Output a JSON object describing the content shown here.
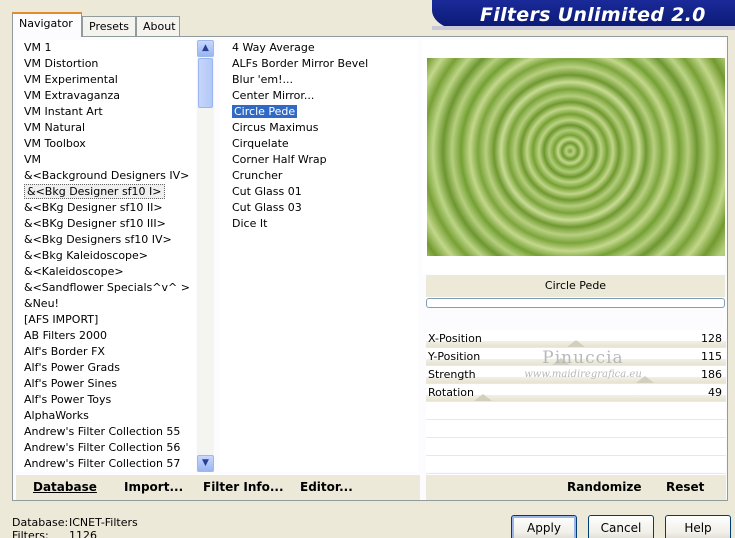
{
  "tabs": [
    "Navigator",
    "Presets",
    "About"
  ],
  "brand_title": "Filters Unlimited 2.0",
  "categories": [
    "VM 1",
    "VM Distortion",
    "VM Experimental",
    "VM Extravaganza",
    "VM Instant Art",
    "VM Natural",
    "VM Toolbox",
    "VM",
    "&<Background Designers IV>",
    "&<Bkg Designer sf10 I>",
    "&<BKg Designer sf10 II>",
    "&<BKg Designer sf10 III>",
    "&<Bkg Designers sf10 IV>",
    "&<Bkg Kaleidoscope>",
    "&<Kaleidoscope>",
    "&<Sandflower Specials^v^ >",
    "&Neu!",
    "[AFS IMPORT]",
    "AB Filters 2000",
    "Alf's Border FX",
    "Alf's Power Grads",
    "Alf's Power Sines",
    "Alf's Power Toys",
    "AlphaWorks",
    "Andrew's Filter Collection 55",
    "Andrew's Filter Collection 56",
    "Andrew's Filter Collection 57"
  ],
  "selected_category": "&<Bkg Designer sf10 I>",
  "filters": [
    "4 Way Average",
    "ALFs Border Mirror Bevel",
    "Blur 'em!...",
    "Center Mirror...",
    "Circle Pede",
    "Circus Maximus",
    "Cirquelate",
    "Corner Half Wrap",
    "Cruncher",
    "Cut Glass 01",
    "Cut Glass 03",
    "Dice It"
  ],
  "selected_filter": "Circle Pede",
  "preview_title": "Circle Pede",
  "params": [
    {
      "label": "X-Position",
      "value": "128",
      "level": 0.5
    },
    {
      "label": "Y-Position",
      "value": "115",
      "level": 0.45
    },
    {
      "label": "Strength",
      "value": "186",
      "level": 0.73
    },
    {
      "label": "Rotation",
      "value": "49",
      "level": 0.19
    }
  ],
  "watermark": {
    "name": "Pinuccia",
    "url": "www.maidiregrafica.eu"
  },
  "bottom_left_buttons": {
    "database": "Database",
    "import": "Import...",
    "filter_info": "Filter Info...",
    "editor": "Editor..."
  },
  "bottom_right_buttons": {
    "randomize": "Randomize",
    "reset": "Reset"
  },
  "status": {
    "database_label": "Database:",
    "database_value": "ICNET-Filters",
    "filters_label": "Filters:",
    "filters_value": "1126"
  },
  "dialog_buttons": {
    "apply": "Apply",
    "cancel": "Cancel",
    "help": "Help"
  },
  "icons": {
    "scroll_up": "scroll-up-icon",
    "scroll_down": "scroll-down-icon"
  },
  "colors": {
    "selection": "#316ac5",
    "brand_bg": "#0e1c80",
    "tab_accent": "#e68b2c"
  }
}
